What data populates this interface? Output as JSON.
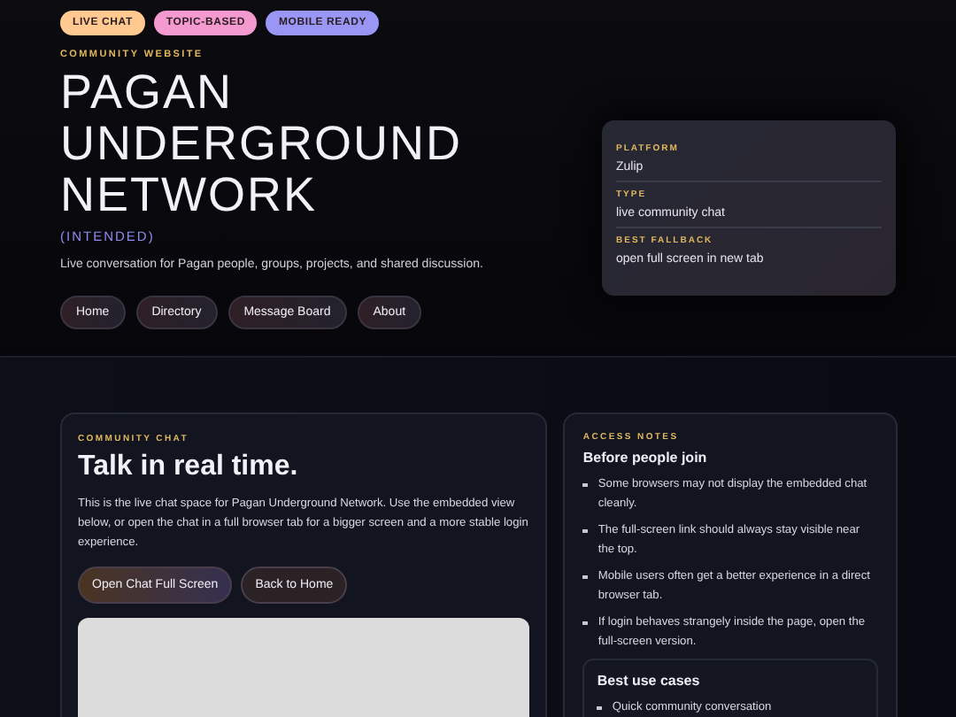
{
  "badges": [
    {
      "label": "LIVE CHAT",
      "color": "#ffc98f"
    },
    {
      "label": "TOPIC-BASED",
      "color": "#f59ad0"
    },
    {
      "label": "MOBILE READY",
      "color": "#9a96f5"
    }
  ],
  "hero": {
    "eyebrow": "COMMUNITY WEBSITE",
    "title_lines": [
      "PAGAN",
      "UNDERGROUND",
      "NETWORK"
    ],
    "subtitle": "(INTENDED)",
    "description": "Live conversation for Pagan people, groups, projects, and shared discussion."
  },
  "nav": [
    "Home",
    "Directory",
    "Message Board",
    "About"
  ],
  "info_card": [
    {
      "label": "PLATFORM",
      "value": "Zulip"
    },
    {
      "label": "TYPE",
      "value": "live community chat"
    },
    {
      "label": "BEST FALLBACK",
      "value": "open full screen in new tab"
    }
  ],
  "chat_card": {
    "eyebrow": "COMMUNITY CHAT",
    "heading": "Talk in real time.",
    "body": "This is the live chat space for Pagan Underground Network. Use the embedded view below, or open the chat in a full browser tab for a bigger screen and a more stable login experience.",
    "buttons": [
      {
        "label": "Open Chat Full Screen",
        "kind": "primary"
      },
      {
        "label": "Back to Home",
        "kind": "secondary"
      }
    ]
  },
  "notes_card": {
    "eyebrow": "ACCESS NOTES",
    "heading": "Before people join",
    "items": [
      "Some browsers may not display the embedded chat cleanly.",
      "The full-screen link should always stay visible near the top.",
      "Mobile users often get a better experience in a direct browser tab.",
      "If login behaves strangely inside the page, open the full-screen version."
    ],
    "use_cases": {
      "heading": "Best use cases",
      "items": [
        "Quick community conversation"
      ]
    }
  }
}
